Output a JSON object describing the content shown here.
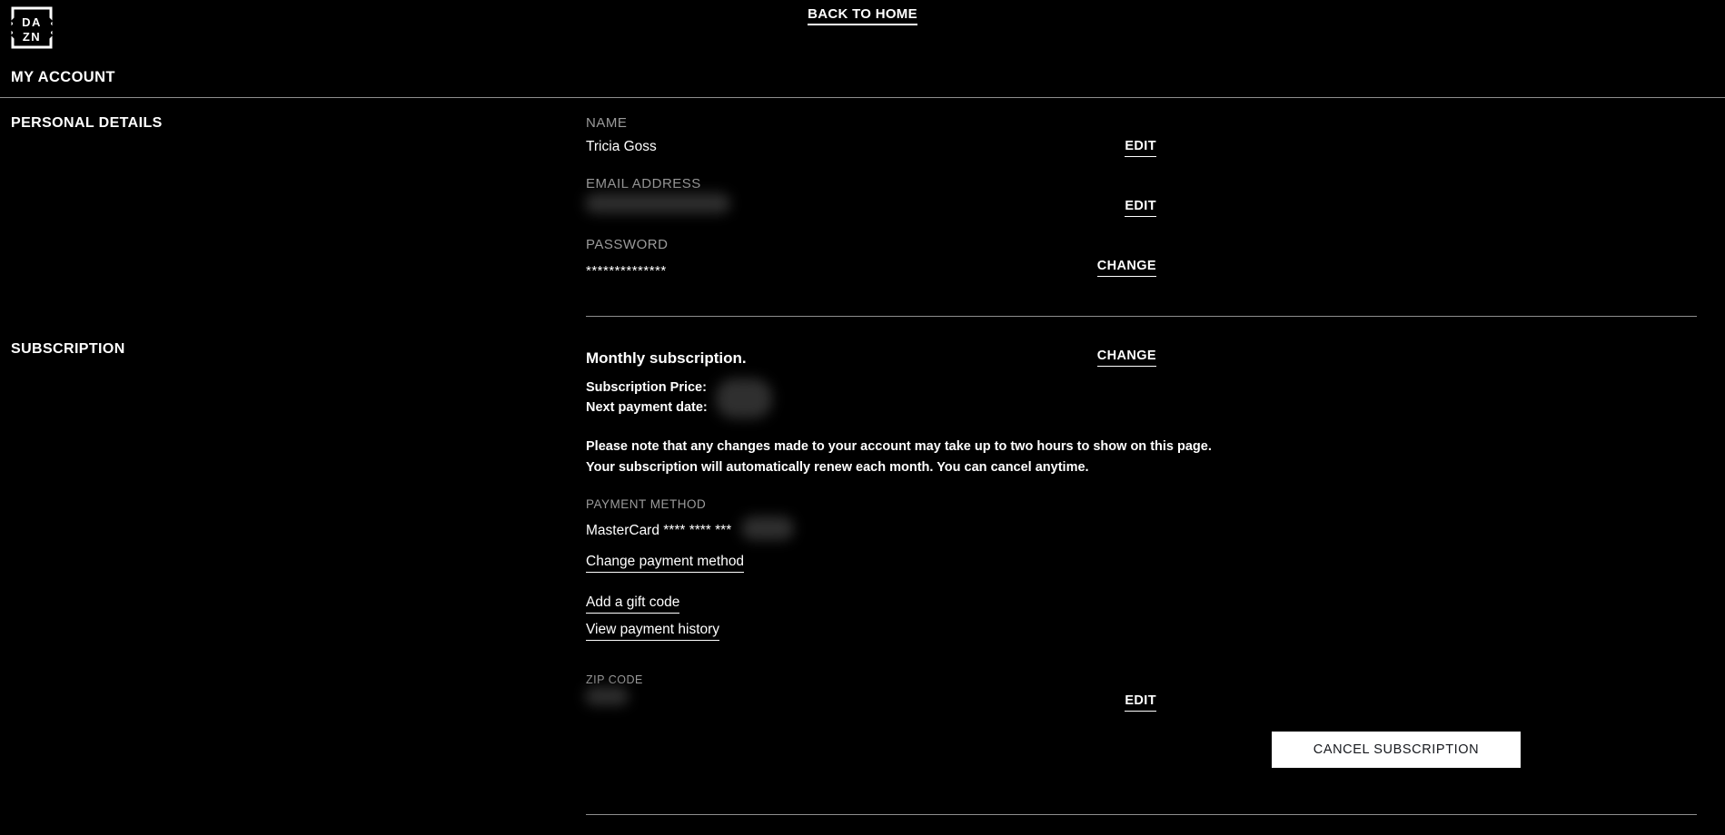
{
  "header": {
    "logo_alt": "DAZN",
    "logo_line1": "DA",
    "logo_line2": "ZN",
    "back_to_home": "BACK TO HOME",
    "page_title": "MY ACCOUNT"
  },
  "personal_details": {
    "section_label": "PERSONAL DETAILS",
    "name": {
      "label": "NAME",
      "value": "Tricia Goss",
      "action": "EDIT"
    },
    "email": {
      "label": "EMAIL ADDRESS",
      "value": "",
      "redacted": true,
      "action": "EDIT"
    },
    "password": {
      "label": "PASSWORD",
      "value": "**************",
      "action": "CHANGE"
    }
  },
  "subscription": {
    "section_label": "SUBSCRIPTION",
    "title": "Monthly subscription.",
    "action": "CHANGE",
    "price_label": "Subscription Price:",
    "price_value": "",
    "next_payment_label": "Next payment date:",
    "next_payment_value": "",
    "note_line_1": "Please note that any changes made to your account may take up to two hours to show on this page.",
    "note_line_2": "Your subscription will automatically renew each month. You can cancel anytime.",
    "payment_method": {
      "label": "PAYMENT METHOD",
      "value": "MasterCard **** **** ***",
      "change_link": "Change payment method"
    },
    "gift_code_link": "Add a gift code",
    "payment_history_link": "View payment history",
    "zip": {
      "label": "ZIP CODE",
      "value": "",
      "action": "EDIT"
    },
    "cancel_button": "CANCEL SUBSCRIPTION"
  },
  "colors": {
    "background": "#000000",
    "text": "#ffffff",
    "muted": "#9b9b9b",
    "rule": "#8e8e8e",
    "button_bg": "#ffffff",
    "button_text": "#16181d"
  }
}
